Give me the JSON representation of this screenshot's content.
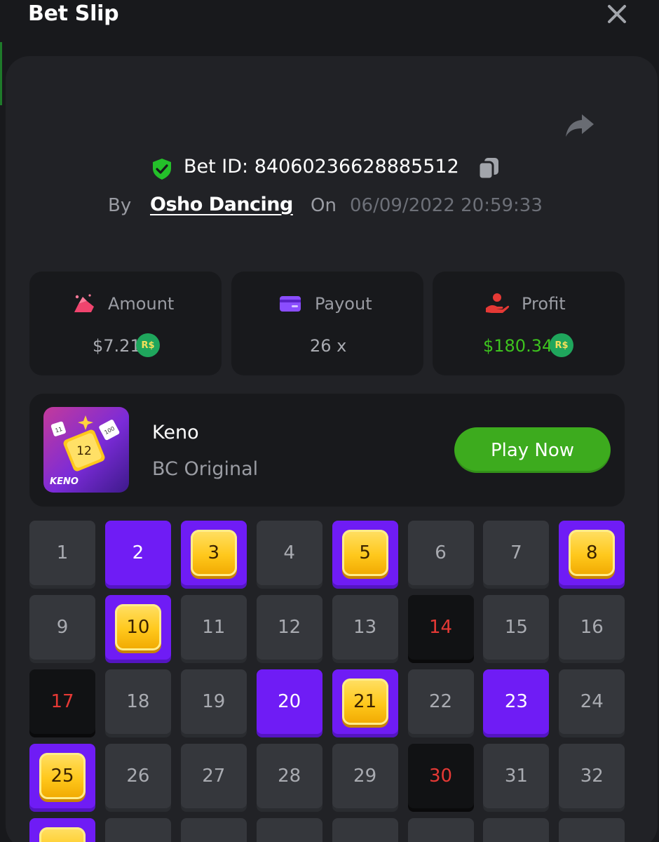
{
  "header": {
    "title": "Bet Slip"
  },
  "bet": {
    "id_text": "Bet ID: 84060236628885512",
    "by_label": "By",
    "user": "Osho Dancing",
    "on_label": "On",
    "datetime": "06/09/2022 20:59:33"
  },
  "stats": {
    "amount": {
      "label": "Amount",
      "value": "$7.21",
      "currency": "R$"
    },
    "payout": {
      "label": "Payout",
      "value": "26 x"
    },
    "profit": {
      "label": "Profit",
      "value": "$180.34",
      "currency": "R$"
    }
  },
  "game": {
    "name": "Keno",
    "provider": "BC Original",
    "thumb_text": "KENO",
    "thumb_number": "12",
    "play_label": "Play Now"
  },
  "keno": {
    "numbers": [
      "1",
      "2",
      "3",
      "4",
      "5",
      "6",
      "7",
      "8",
      "9",
      "10",
      "11",
      "12",
      "13",
      "14",
      "15",
      "16",
      "17",
      "18",
      "19",
      "20",
      "21",
      "22",
      "23",
      "24",
      "25",
      "26",
      "27",
      "28",
      "29",
      "30",
      "31",
      "32"
    ],
    "selected": [
      "2",
      "20",
      "23"
    ],
    "hits": [
      "3",
      "5",
      "8",
      "10",
      "21",
      "25"
    ],
    "drawn_misses": [
      "14",
      "17",
      "30"
    ]
  },
  "colors": {
    "background": "#18191c",
    "panel": "#212226",
    "accent_purple": "#6f1cf5",
    "play_green": "#3dab1e",
    "profit_green": "#3dc31e",
    "miss_red": "#e53935",
    "verified_green": "#24c02a"
  },
  "icons": {
    "close": "close-icon",
    "share": "share-icon",
    "verified": "shield-check-icon",
    "copy": "copy-icon",
    "amount": "bet-amount-icon",
    "payout": "card-icon",
    "profit": "hand-coin-icon"
  }
}
